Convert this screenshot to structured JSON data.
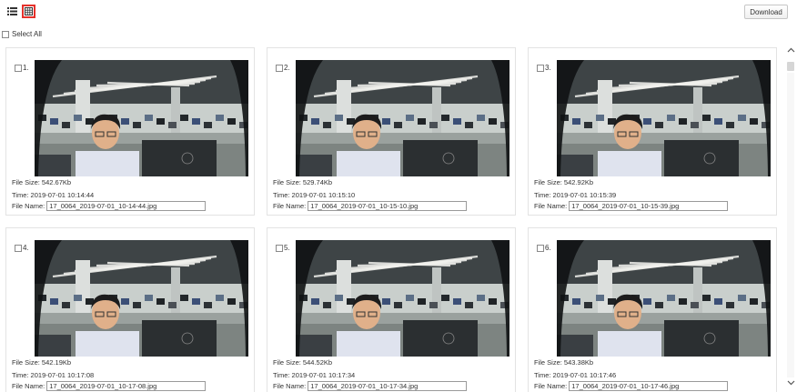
{
  "toolbar": {
    "list_view_icon": "list-icon",
    "grid_view_icon": "grid-icon",
    "download_label": "Download",
    "active_view_color": "#e5312b"
  },
  "select_all": {
    "label": "Select All",
    "checked": false
  },
  "images": [
    {
      "index": "1.",
      "file_size": "File Size: 542.67Kb",
      "time": "Time: 2019-07-01 10:14:44",
      "file_name_label": "File Name:",
      "file_name": "17_0064_2019-07-01_10-14-44.jpg",
      "checked": false
    },
    {
      "index": "2.",
      "file_size": "File Size: 529.74Kb",
      "time": "Time: 2019-07-01 10:15:10",
      "file_name_label": "File Name:",
      "file_name": "17_0064_2019-07-01_10-15-10.jpg",
      "checked": false
    },
    {
      "index": "3.",
      "file_size": "File Size: 542.92Kb",
      "time": "Time: 2019-07-01 10:15:39",
      "file_name_label": "File Name:",
      "file_name": "17_0064_2019-07-01_10-15-39.jpg",
      "checked": false
    },
    {
      "index": "4.",
      "file_size": "File Size: 542.19Kb",
      "time": "Time: 2019-07-01 10:17:08",
      "file_name_label": "File Name:",
      "file_name": "17_0064_2019-07-01_10-17-08.jpg",
      "checked": false
    },
    {
      "index": "5.",
      "file_size": "File Size: 544.52Kb",
      "time": "Time: 2019-07-01 10:17:34",
      "file_name_label": "File Name:",
      "file_name": "17_0064_2019-07-01_10-17-34.jpg",
      "checked": false
    },
    {
      "index": "6.",
      "file_size": "File Size: 543.38Kb",
      "time": "Time: 2019-07-01 10:17:46",
      "file_name_label": "File Name:",
      "file_name": "17_0064_2019-07-01_10-17-46.jpg",
      "checked": false
    }
  ]
}
